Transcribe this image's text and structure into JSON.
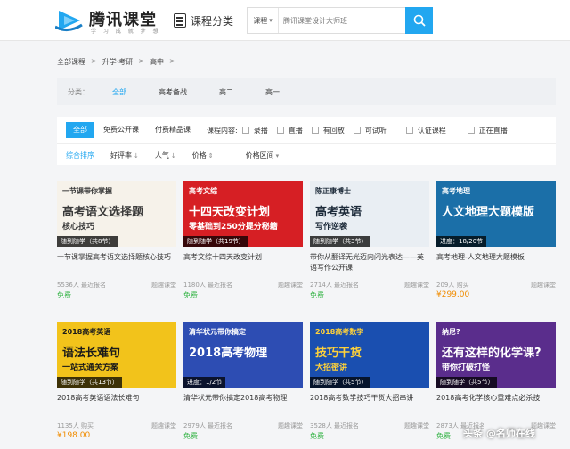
{
  "header": {
    "logo_title": "腾讯课堂",
    "logo_sub": "学 习 成 就 梦 想",
    "category_nav": "课程分类",
    "search_select": "课程",
    "search_placeholder": "腾讯课堂设计大师班"
  },
  "breadcrumb": [
    "全部课程",
    "升学·考研",
    "高中"
  ],
  "filter_category": {
    "label": "分类：",
    "items": [
      "全部",
      "高考备战",
      "高二",
      "高一"
    ],
    "active_index": 0
  },
  "filter_bar": {
    "tabs": [
      "全部",
      "免费公开课",
      "付费精品课"
    ],
    "active_tab": 0,
    "content_label": "课程内容:",
    "content_options": [
      "录播",
      "直播",
      "有回放",
      "可试听"
    ],
    "extra_options": [
      "认证课程",
      "正在直播"
    ],
    "sorts": [
      {
        "label": "综合排序",
        "arrow": ""
      },
      {
        "label": "好评率",
        "arrow": "↓"
      },
      {
        "label": "人气",
        "arrow": "↓"
      },
      {
        "label": "价格",
        "arrow": "⇕"
      },
      {
        "label": "价格区间",
        "arrow": "▾"
      }
    ]
  },
  "courses": [
    {
      "thumb_text1": "一节课带你掌握",
      "thumb_text2": "高考语文选择题",
      "thumb_text3": "核心技巧",
      "thumb_bg": "#f6f2ea",
      "thumb_fg": "#3a3a3a",
      "strip": "随到随学（共8节）",
      "title": "一节课掌握高考语文选择题核心技巧",
      "count": "5536人 最近报名",
      "org": "题趣课堂",
      "price": "免费",
      "free": true
    },
    {
      "thumb_text1": "高考文综",
      "thumb_text2": "十四天改变计划",
      "thumb_text3": "零基础到250分提分秘籍",
      "thumb_bg": "#d61f24",
      "thumb_fg": "#ffffff",
      "strip": "随到随学（共19节）",
      "title": "高考文综十四天改变计划",
      "count": "1180人 最近报名",
      "org": "题趣课堂",
      "price": "免费",
      "free": true
    },
    {
      "thumb_text1": "陈正康博士",
      "thumb_text2": "高考英语",
      "thumb_text3": "写作逆袭",
      "thumb_bg": "#e9eef3",
      "thumb_fg": "#1d2b3a",
      "strip": "随到随学（共3节）",
      "title": "带你从翻译无光迈向闪光表达——英语写作公开课",
      "count": "2714人 最近报名",
      "org": "题趣课堂",
      "price": "免费",
      "free": true
    },
    {
      "thumb_text1": "高考地理",
      "thumb_text2": "人文地理大题模版",
      "thumb_text3": "",
      "thumb_bg": "#1b6fa8",
      "thumb_fg": "#ffffff",
      "strip": "进度：18/20节",
      "title": "高考地理-人文地理大题模板",
      "count": "209人 购买",
      "org": "题趣课堂",
      "price": "¥299.00",
      "free": false
    },
    {
      "thumb_text1": "2018高考英语",
      "thumb_text2": "语法长难句",
      "thumb_text3": "一站式通关方案",
      "thumb_bg": "#f2c31b",
      "thumb_fg": "#1a1a1a",
      "strip": "随到随学（共13节）",
      "title": "2018高考英语语法长难句",
      "count": "1135人 购买",
      "org": "题趣课堂",
      "price": "¥198.00",
      "free": false
    },
    {
      "thumb_text1": "清华状元带你搞定",
      "thumb_text2": "2018高考物理",
      "thumb_text3": "",
      "thumb_bg": "#2d4db3",
      "thumb_fg": "#ffffff",
      "strip": "进度：1/2节",
      "title": "清华状元带你搞定2018高考物理",
      "count": "2979人 最近报名",
      "org": "题趣课堂",
      "price": "免费",
      "free": true
    },
    {
      "thumb_text1": "2018高考数学",
      "thumb_text2": "技巧干货",
      "thumb_text3": "大招密讲",
      "thumb_bg": "#1a4fb0",
      "thumb_fg": "#ffd23a",
      "strip": "随到随学（共5节）",
      "title": "2018高考数学技巧干货大招串讲",
      "count": "3528人 最近报名",
      "org": "题趣课堂",
      "price": "免费",
      "free": true
    },
    {
      "thumb_text1": "纳尼?",
      "thumb_text2": "还有这样的化学课?",
      "thumb_text3": "带你打破打怪",
      "thumb_bg": "#5a2d8c",
      "thumb_fg": "#ffffff",
      "strip": "随到随学（共5节）",
      "title": "2018高考化学核心重难点必杀技",
      "count": "2873人 最近报名",
      "org": "题趣课堂",
      "price": "免费",
      "free": true
    }
  ],
  "watermark": "头条 @名师在线"
}
